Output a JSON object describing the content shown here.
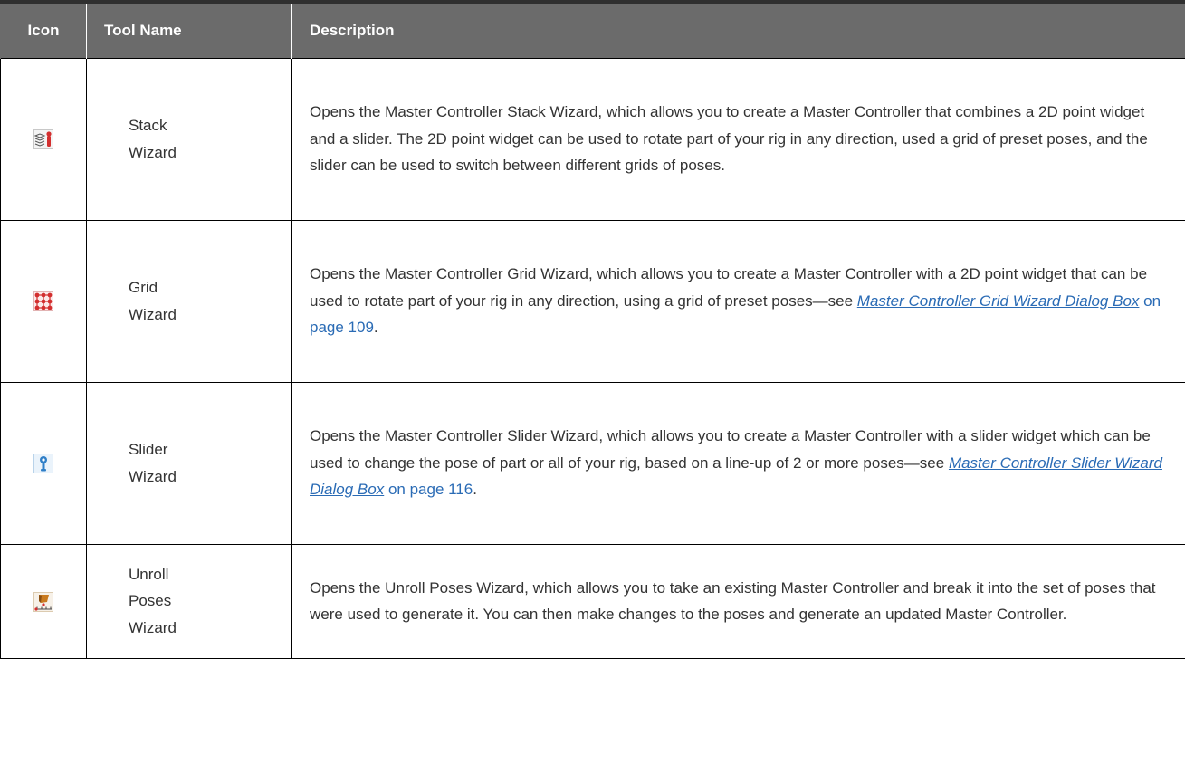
{
  "table": {
    "headers": {
      "icon": "Icon",
      "tool_name": "Tool Name",
      "description": "Description"
    },
    "rows": [
      {
        "icon": "stack-wizard-icon",
        "name_lines": [
          "Stack",
          "Wizard"
        ],
        "description": "Opens the Master Controller Stack Wizard, which allows you to create a Master Controller that combines a 2D point widget and a slider. The 2D point widget can be used to rotate part of your rig in any direction, used a grid of preset poses, and the slider can be used to switch between different grids of poses."
      },
      {
        "icon": "grid-wizard-icon",
        "name_lines": [
          "Grid",
          "Wizard"
        ],
        "description_pre": "Opens the Master Controller Grid Wizard, which allows you to create a Master Controller with a 2D point widget that can be used to rotate part of your rig in any direction, using a grid of preset poses—see ",
        "link_text": "Master Controller Grid Wizard Dialog Box",
        "link_page": " on page 109",
        "description_post": "."
      },
      {
        "icon": "slider-wizard-icon",
        "name_lines": [
          "Slider",
          "Wizard"
        ],
        "description_pre": "Opens the Master Controller Slider Wizard, which allows you to create a Master Controller with a slider widget which can be used to change the pose of part or all of your rig, based on a line-up of 2 or more poses—see ",
        "link_text": "Master Controller Slider Wizard Dialog Box",
        "link_page": " on page 116",
        "description_post": "."
      },
      {
        "icon": "unroll-poses-wizard-icon",
        "name_lines": [
          "Unroll",
          "Poses",
          "Wizard"
        ],
        "description": "Opens the Unroll Poses Wizard, which allows you to take an existing Master Controller and break it into the set of poses that were used to generate it. You can then make changes to the poses and generate an updated Master Controller."
      }
    ]
  },
  "colors": {
    "header_bg": "#6b6b6b",
    "header_text": "#ffffff",
    "body_text": "#333333",
    "link": "#2a6bb5",
    "icon_red": "#d32f2f",
    "icon_blue": "#2f7fc8"
  }
}
